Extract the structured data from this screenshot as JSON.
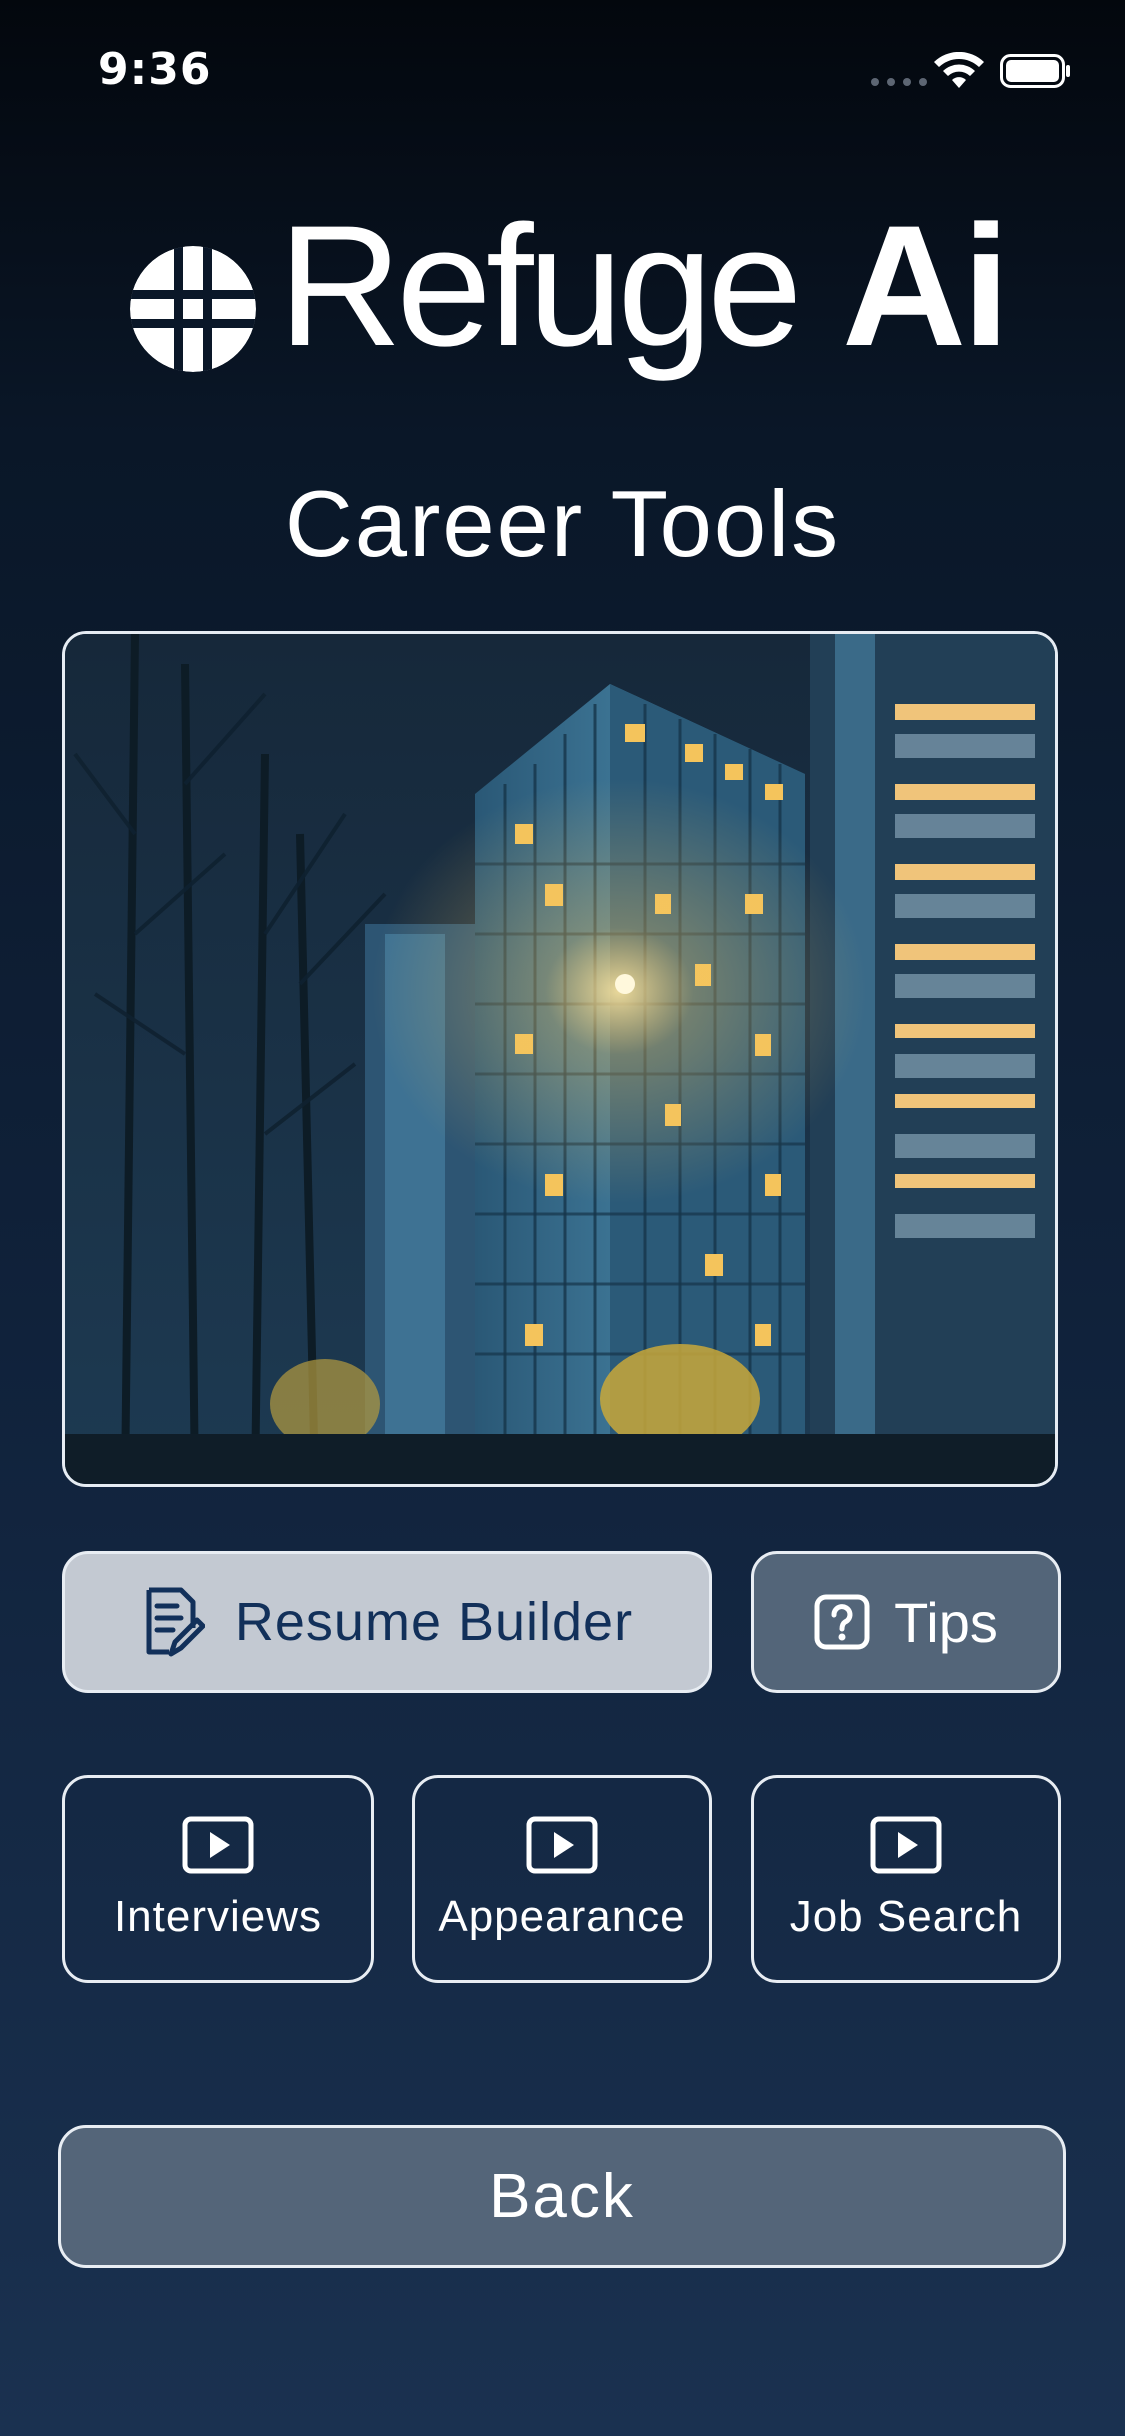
{
  "status_bar": {
    "time": "9:36"
  },
  "header": {
    "logo_word": "Refuge",
    "logo_ai": "Ai",
    "page_title": "Career Tools"
  },
  "hero": {
    "description_icon": "night-office-building-painting"
  },
  "actions": {
    "resume_label": "Resume Builder",
    "resume_icon": "document-edit-icon",
    "tips_label": "Tips",
    "tips_icon": "question-square-icon"
  },
  "videos": [
    {
      "label": "Interviews",
      "icon": "play-icon"
    },
    {
      "label": "Appearance",
      "icon": "play-icon"
    },
    {
      "label": "Job Search",
      "icon": "play-icon"
    }
  ],
  "footer": {
    "back_label": "Back"
  },
  "colors": {
    "background_top": "#03070d",
    "background_bottom": "#1a3150",
    "resume_button_bg": "#c3c9d2",
    "resume_button_text": "#12305a",
    "tips_button_bg": "#536579",
    "back_button_bg": "#546579"
  }
}
